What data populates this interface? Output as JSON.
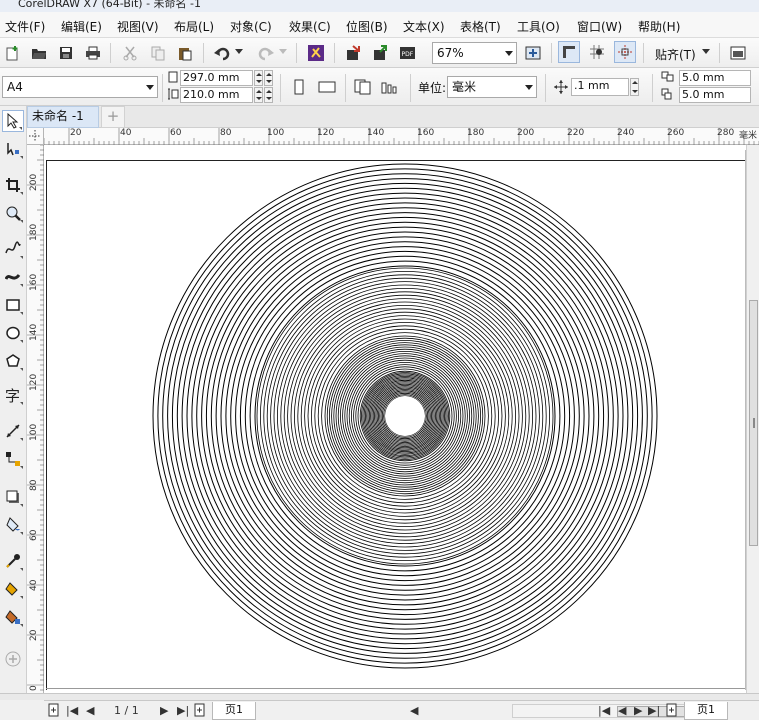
{
  "window": {
    "title": "CorelDRAW X7 (64-Bit) - 未命名 -1"
  },
  "menu": [
    {
      "label": "文件(F)"
    },
    {
      "label": "编辑(E)"
    },
    {
      "label": "视图(V)"
    },
    {
      "label": "布局(L)"
    },
    {
      "label": "对象(C)"
    },
    {
      "label": "效果(C)"
    },
    {
      "label": "位图(B)"
    },
    {
      "label": "文本(X)"
    },
    {
      "label": "表格(T)"
    },
    {
      "label": "工具(O)"
    },
    {
      "label": "窗口(W)"
    },
    {
      "label": "帮助(H)"
    }
  ],
  "toolbar": {
    "zoom_level": "67%",
    "snap_label": "贴齐(T)"
  },
  "property_bar": {
    "page_size": "A4",
    "width": "297.0 mm",
    "height": "210.0 mm",
    "units_label": "单位:",
    "units_value": "毫米",
    "nudge": ".1 mm",
    "dup_x": "5.0 mm",
    "dup_y": "5.0 mm"
  },
  "tabs": {
    "document_tab": "未命名 -1",
    "add_tab": "+"
  },
  "rulers": {
    "horizontal": [
      "20",
      "40",
      "60",
      "80",
      "100",
      "120",
      "140",
      "160",
      "180",
      "200",
      "220",
      "240",
      "260",
      "280"
    ],
    "horizontal_unit": "毫米",
    "vertical": [
      "200",
      "180",
      "160",
      "140",
      "120",
      "100",
      "80",
      "60",
      "40",
      "20",
      "0"
    ],
    "vertical_unit": "毫米"
  },
  "drawing": {
    "shape": "concentric-circles",
    "ring_count": 22,
    "stroke_color": "#000000",
    "center_hole_color": "#ffffff"
  },
  "statusbar": {
    "page_counter": "1 / 1",
    "page_tab_left": "页1",
    "page_tab_right": "页1"
  },
  "colors": {
    "accent": "#9ab7dd",
    "selection": "#dbe7f6"
  }
}
